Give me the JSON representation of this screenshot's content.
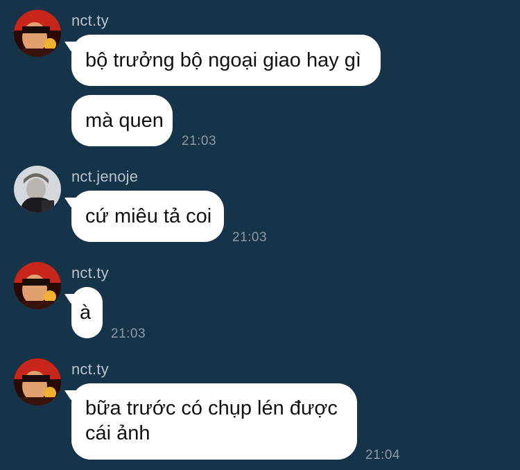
{
  "messages": [
    {
      "sender": "nct.ty",
      "bubbles": [
        "bộ trưởng bộ ngoại giao hay gì",
        "mà quen"
      ],
      "time": "21:03"
    },
    {
      "sender": "nct.jenoje",
      "bubbles": [
        "cứ miêu tả coi"
      ],
      "time": "21:03"
    },
    {
      "sender": "nct.ty",
      "bubbles": [
        "à"
      ],
      "time": "21:03"
    },
    {
      "sender": "nct.ty",
      "bubbles": [
        "bữa trước có chụp lén được cái ảnh"
      ],
      "time": "21:04"
    }
  ],
  "colors": {
    "background": "#153349",
    "bubble": "#ffffff",
    "sender_text": "#b7c2cc",
    "time_text": "#8e9ba7"
  }
}
